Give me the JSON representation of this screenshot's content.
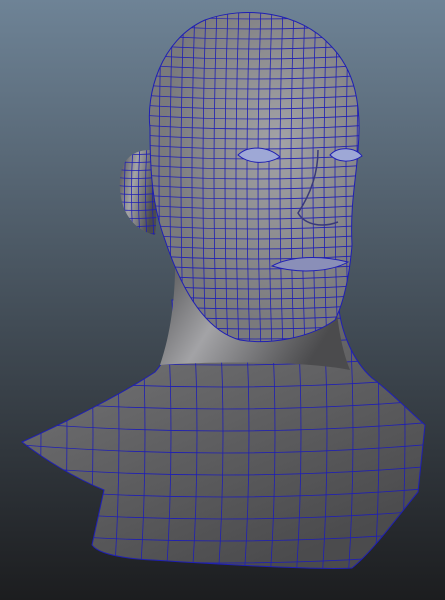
{
  "viewport": {
    "panel": "3d-viewport",
    "background_top": "#6e8396",
    "background_bottom": "#1c1d1f"
  },
  "model": {
    "subject": "head-and-shoulders-bust",
    "display_mode": "wireframe-on-shaded",
    "surface_color": "#7a7a7c",
    "surface_highlight": "#a3a3a6",
    "surface_shadow": "#4b4b4d",
    "wire_color": "#1f1fb4"
  }
}
